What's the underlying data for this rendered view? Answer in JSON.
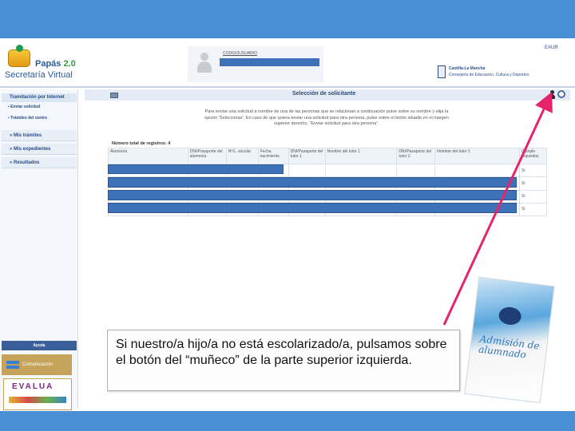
{
  "header": {
    "logo_title": "Papás",
    "logo_version": "2.0",
    "logo_subtitle": "Secretaría Virtual",
    "user_label": "CODIGOUSUARIO",
    "language_link": "EAUR",
    "gov_name": "Castilla-La Mancha",
    "gov_dept": "Consejería de Educación, Cultura y Deportes"
  },
  "sidebar": {
    "section_title": "Tramitación por Internet",
    "links": [
      "Enviar solicitud",
      "Trámites del centro"
    ],
    "items": [
      "Mis trámites",
      "Mis expedientes",
      "Resultados"
    ],
    "help_label": "Ayuda",
    "communication_label": "Comunicación",
    "evalua_label": "EVALUA"
  },
  "main": {
    "title": "Selección de solicitante",
    "instructions": "Para enviar una solicitud a nombre de una de las personas que se relacionan a continuación pulse sobre su nombre y elija la opción 'Seleccionar'. En caso de que quiera enviar una solicitud para otra persona, pulse sobre el botón situado en el margen superior derecho, \"Enviar solicitud para otra persona\".",
    "count_label": "Número total de registros: 4",
    "columns": [
      "Alumno/a",
      "DNI/Pasaporte del alumno/a",
      "Nº/L. escolar",
      "Fecha nacimiento",
      "DNI/Pasaporte del tutor 1",
      "Nombre del tutor 1",
      "DNI/Pasaporte del tutor 2",
      "Nombre del tutor 2",
      "Cumple requisitos"
    ],
    "rows_last_col": [
      "Sí",
      "Sí",
      "Sí",
      "Sí"
    ]
  },
  "callout": {
    "text": "Si nuestro/a hijo/a no está escolarizado/a, pulsamos sobre el botón del “muñeco” de la parte superior izquierda."
  },
  "poster": {
    "title": "Admisión de alumnado"
  },
  "colors": {
    "band": "#4a8fd6",
    "redacted_bar": "#3d72b8",
    "arrow": "#e6246e"
  }
}
